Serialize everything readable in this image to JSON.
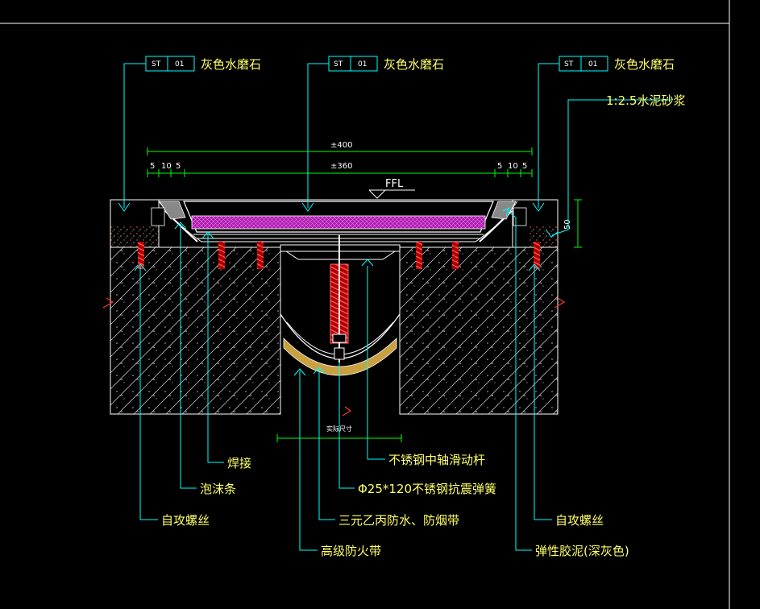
{
  "tags": [
    {
      "code": "ST",
      "num": "01",
      "material": "灰色水磨石"
    },
    {
      "code": "ST",
      "num": "01",
      "material": "灰色水磨石"
    },
    {
      "code": "ST",
      "num": "01",
      "material": "灰色水磨石"
    }
  ],
  "mortar": "1:2.5水泥砂浆",
  "ffl": "FFL",
  "dims": {
    "overall": "±400",
    "inner": "±360",
    "left_parts": [
      "5",
      "10",
      "5"
    ],
    "right_parts": [
      "5",
      "10",
      "5"
    ],
    "height": "50",
    "gap": "实际尺寸"
  },
  "callouts": {
    "weld": "焊接",
    "foam": "泡沫条",
    "screw_left": "自攻螺丝",
    "rod": "不锈钢中轴滑动杆",
    "spring": "Φ25*120不锈钢抗震弹簧",
    "epdm": "三元乙丙防水、防烟带",
    "fireband": "高级防火带",
    "screw_right": "自攻螺丝",
    "sealant": "弹性胶泥(深灰色)"
  },
  "colors": {
    "leader": "#00ffff",
    "label": "#ffff66",
    "concrete": "#ffffff",
    "screw": "#ff3333",
    "rubber": "#cc33cc",
    "dim": "#00ff00",
    "frame": "#ffffff"
  }
}
